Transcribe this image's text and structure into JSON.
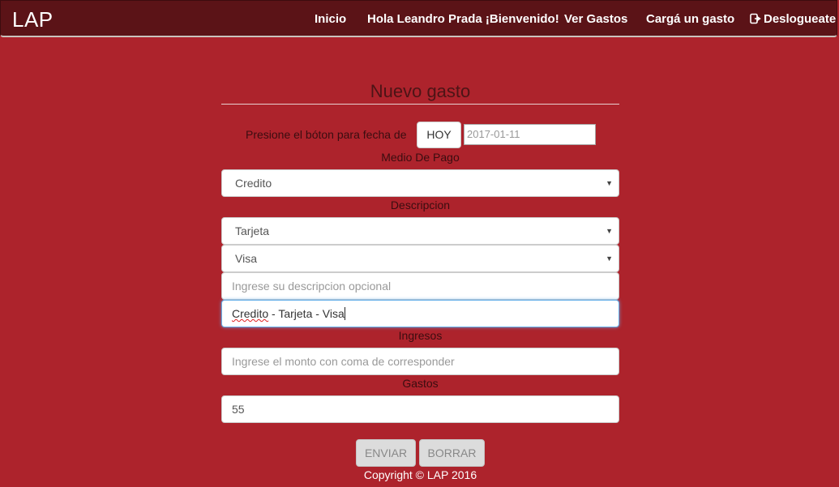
{
  "navbar": {
    "brand": "LAP",
    "links": {
      "inicio": "Inicio",
      "hola": "Hola Leandro Prada ¡Bienvenido!",
      "ver_gastos": "Ver Gastos",
      "carga_gasto": "Cargá un gasto",
      "logout": "Deslogueate"
    }
  },
  "form": {
    "title": "Nuevo gasto",
    "date_label": "Presione el bóton para fecha de",
    "hoy_button": "HOY",
    "date_value": "2017-01-11",
    "medio_pago_label": "Medio De Pago",
    "medio_pago_value": "Credito",
    "descripcion_label": "Descripcion",
    "descripcion_tipo_value": "Tarjeta",
    "descripcion_marca_value": "Visa",
    "descripcion_opcional_placeholder": "Ingrese su descripcion opcional",
    "descripcion_result_part1": "Credito",
    "descripcion_result_part2": " - Tarjeta - Visa",
    "ingresos_label": "Ingresos",
    "ingresos_placeholder": "Ingrese el monto con coma de corresponder",
    "gastos_label": "Gastos",
    "gastos_value": "55",
    "enviar_button": "ENVIAR",
    "borrar_button": "BORRAR"
  },
  "footer": {
    "copyright": "Copyright © LAP 2016"
  },
  "colors": {
    "background": "#ad232c",
    "navbar": "#5b1317"
  }
}
